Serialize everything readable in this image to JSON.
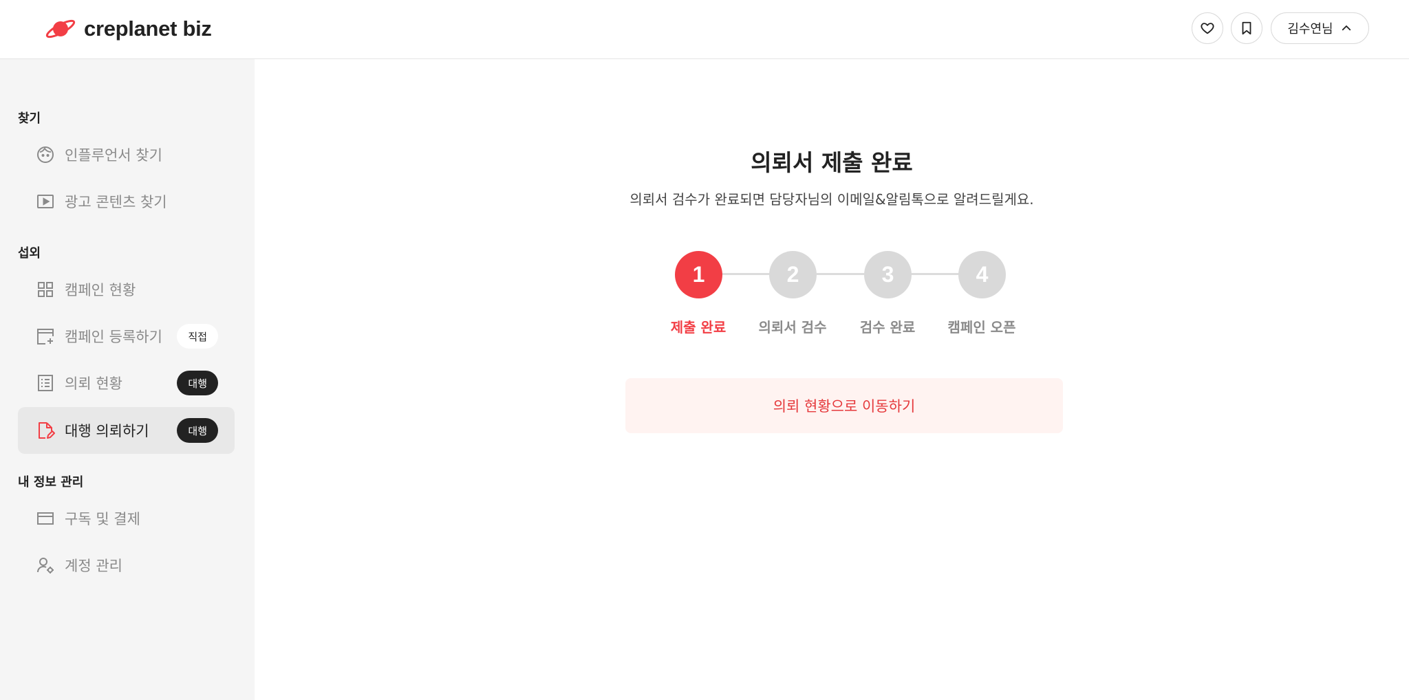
{
  "header": {
    "logo_text": "creplanet biz",
    "user_name": "김수연님",
    "brand_color": "#f23e45"
  },
  "sidebar": {
    "sections": [
      {
        "title": "찾기"
      },
      {
        "title": "섭외"
      },
      {
        "title": "내 정보 관리"
      }
    ],
    "items": [
      {
        "label": "인플루언서 찾기",
        "icon": "face-icon"
      },
      {
        "label": "광고 콘텐츠 찾기",
        "icon": "play-icon"
      },
      {
        "label": "캠페인 현황",
        "icon": "grid-icon"
      },
      {
        "label": "캠페인 등록하기",
        "icon": "calendar-add-icon",
        "badge": "직접"
      },
      {
        "label": "의뢰 현황",
        "icon": "list-icon",
        "badge": "대행"
      },
      {
        "label": "대행 의뢰하기",
        "icon": "document-edit-icon",
        "badge": "대행",
        "active": true
      },
      {
        "label": "구독 및 결제",
        "icon": "card-icon"
      },
      {
        "label": "계정 관리",
        "icon": "user-settings-icon"
      }
    ]
  },
  "main": {
    "title": "의뢰서 제출 완료",
    "subtitle": "의뢰서 검수가 완료되면 담당자님의 이메일&알림톡으로 알려드릴게요.",
    "steps": [
      {
        "number": "1",
        "label": "제출 완료",
        "active": true
      },
      {
        "number": "2",
        "label": "의뢰서 검수",
        "active": false
      },
      {
        "number": "3",
        "label": "검수 완료",
        "active": false
      },
      {
        "number": "4",
        "label": "캠페인 오픈",
        "active": false
      }
    ],
    "cta_label": "의뢰 현황으로 이동하기"
  }
}
